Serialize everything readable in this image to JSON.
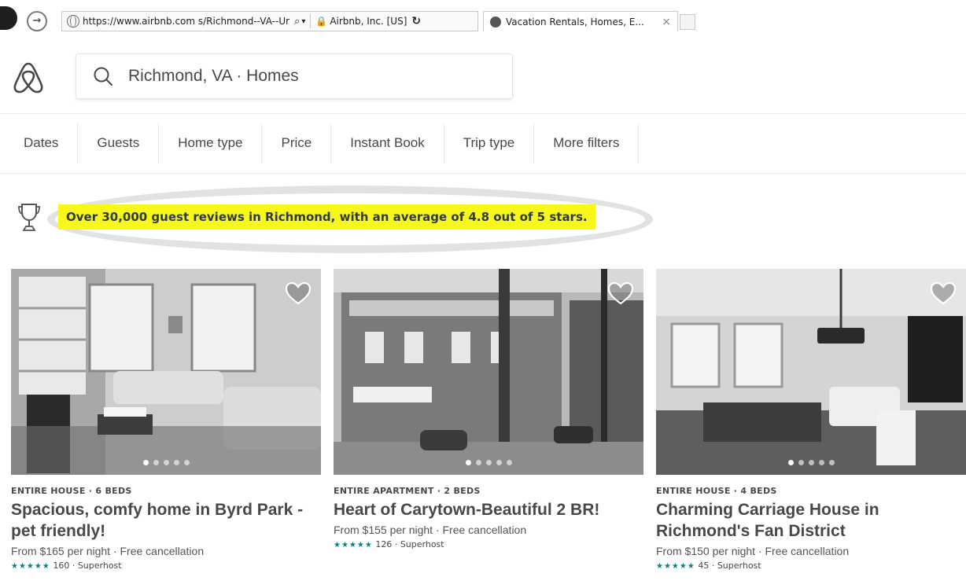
{
  "browser": {
    "url": "https://www.airbnb.com s/Richmond--VA--Ur",
    "certificate": "Airbnb, Inc. [US]",
    "tab_title": "Vacation Rentals, Homes, E...",
    "tab_close": "×",
    "search_glyph": "⌕",
    "dropdown_glyph": "▾",
    "refresh_glyph": "↻",
    "lock_glyph": "🔒",
    "forward_glyph": "→"
  },
  "header": {
    "search_value": "Richmond, VA · Homes",
    "logo_icon": "airbnb-belo-icon",
    "search_icon": "search-icon"
  },
  "filters": [
    "Dates",
    "Guests",
    "Home type",
    "Price",
    "Instant Book",
    "Trip type",
    "More filters"
  ],
  "banner": {
    "text": "Over 30,000 guest reviews in Richmond, with an average of 4.8 out of 5 stars.",
    "highlight_color": "#f7f719",
    "icon": "trophy-icon"
  },
  "listings": [
    {
      "kicker": "ENTIRE HOUSE · 6 BEDS",
      "title": "Spacious, comfy home in Byrd Park - pet friendly!",
      "price": "From $165 per night · Free cancellation",
      "stars": "★★★★★",
      "reviews": "160 · Superhost"
    },
    {
      "kicker": "ENTIRE APARTMENT · 2 BEDS",
      "title": "Heart of Carytown-Beautiful 2 BR!",
      "price": "From $155 per night · Free cancellation",
      "stars": "★★★★★",
      "reviews": "126 · Superhost"
    },
    {
      "kicker": "ENTIRE HOUSE · 4 BEDS",
      "title": "Charming Carriage House in Richmond's Fan District",
      "price": "From $150 per night · Free cancellation",
      "stars": "★★★★★",
      "reviews": "45 · Superhost"
    }
  ],
  "colors": {
    "text": "#484848",
    "rating_stars": "#008489",
    "brand": "#ff5a5f"
  }
}
